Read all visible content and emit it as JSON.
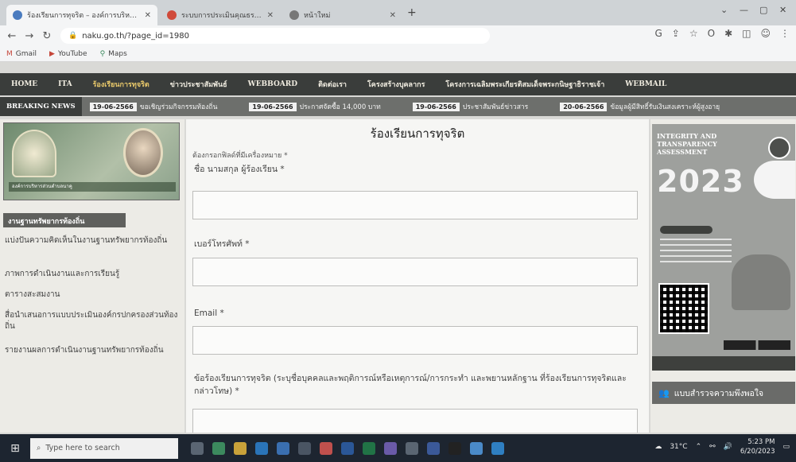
{
  "browser": {
    "tabs": [
      {
        "title": "ร้องเรียนการทุจริต – องค์การบริหารส่วนตำบล",
        "active": true,
        "favicon_color": "#4a7bbf"
      },
      {
        "title": "ระบบการประเมินคุณธรรมและความโปร่งใส",
        "active": false,
        "favicon_color": "#d04a3a"
      },
      {
        "title": "หน้าใหม่",
        "active": false,
        "favicon_color": "#777777"
      }
    ],
    "url": "naku.go.th/?page_id=1980",
    "bookmarks": [
      {
        "label": "Gmail",
        "icon": "gmail-icon"
      },
      {
        "label": "YouTube",
        "icon": "youtube-icon"
      },
      {
        "label": "Maps",
        "icon": "maps-icon"
      }
    ]
  },
  "menu": {
    "items": [
      "HOME",
      "ITA",
      "ร้องเรียนการทุจริต",
      "ข่าวประชาสัมพันธ์",
      "WEBBOARD",
      "ติดต่อเรา",
      "โครงสร้างบุคลากร",
      "โครงการเฉลิมพระเกียรติสมเด็จพระกนิษฐาธิราชเจ้า",
      "WEBMAIL"
    ],
    "current_index": 2
  },
  "breaking": {
    "label": "BREAKING NEWS",
    "items": [
      {
        "date": "19-06-2566",
        "text": "ขอเชิญร่วมกิจกรรมท้องถิ่น"
      },
      {
        "date": "19-06-2566",
        "text": "ประกาศจัดซื้อ 14,000 บาท"
      },
      {
        "date": "19-06-2566",
        "text": "ประชาสัมพันธ์ข่าวสาร"
      },
      {
        "date": "20-06-2566",
        "text": "ข้อมูลผู้มีสิทธิ์รับเงินสงเคราะห์ผู้สูงอายุ"
      }
    ]
  },
  "left": {
    "banner_caption": "องค์การบริหารส่วนตำบลนาคู",
    "section_title": "งานฐานทรัพยากรท้องถิ่น",
    "links": [
      "แบ่งปันความคิดเห็นในงานฐานทรัพยากรท้องถิ่น",
      "ภาพการดำเนินงานและการเรียนรู้",
      "ตารางสะสมงาน",
      "สื่อนำเสนอการแบบประเมินองค์กรปกครองส่วนท้องถิ่น",
      "รายงานผลการดำเนินงานฐานทรัพยากรท้องถิ่น"
    ]
  },
  "form": {
    "title": "ร้องเรียนการทุจริต",
    "required_note": "ต้องกรอกฟิลด์ที่มีเครื่องหมาย *",
    "fields": [
      {
        "label": "ชื่อ นามสกุล ผู้ร้องเรียน *",
        "value": ""
      },
      {
        "label": "เบอร์โทรศัพท์ *",
        "value": ""
      },
      {
        "label": "Email *",
        "value": ""
      },
      {
        "label": "ข้อร้องเรียนการทุจริต (ระบุชื่อบุคคลและพฤติการณ์หรือเหตุการณ์/การกระทำ และพยานหลักฐาน ที่ร้องเรียนการทุจริตและกล่าวโทษ) *",
        "value": ""
      }
    ]
  },
  "right": {
    "ita_heading": "INTEGRITY AND\nTRANSPARENCY\nASSESSMENT",
    "ita_year": "2023",
    "survey_label": "แบบสำรวจความพึงพอใจ",
    "survey_icon": "people-icon"
  },
  "taskbar": {
    "search_placeholder": "Type here to search",
    "weather": "31°C",
    "time": "5:23 PM",
    "date": "6/20/2023",
    "icons": [
      {
        "name": "task-view-icon",
        "color": "#5a6572"
      },
      {
        "name": "chrome-icon",
        "color": "#3c8a5e"
      },
      {
        "name": "explorer-icon",
        "color": "#c9a23a"
      },
      {
        "name": "edge-icon",
        "color": "#2a74b8"
      },
      {
        "name": "mail-icon",
        "color": "#3a6fb0"
      },
      {
        "name": "store-icon",
        "color": "#4a5563"
      },
      {
        "name": "media-icon",
        "color": "#c0504d"
      },
      {
        "name": "word-icon",
        "color": "#2b5797"
      },
      {
        "name": "excel-icon",
        "color": "#217346"
      },
      {
        "name": "photos-icon",
        "color": "#6a5aa8"
      },
      {
        "name": "settings-icon",
        "color": "#5a6572"
      },
      {
        "name": "facebook-icon",
        "color": "#3b5998"
      },
      {
        "name": "tiktok-icon",
        "color": "#222222"
      },
      {
        "name": "app-icon",
        "color": "#4a8ac8"
      },
      {
        "name": "browser-icon",
        "color": "#2f7fc1"
      }
    ]
  }
}
